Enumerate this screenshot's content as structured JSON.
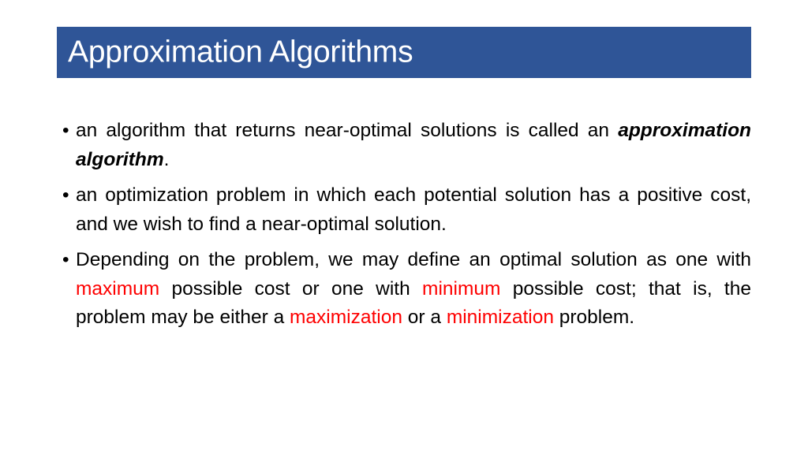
{
  "slide": {
    "title": "Approximation Algorithms",
    "banner_color": "#2f5597",
    "title_color": "#ffffff",
    "background_color": "#ffffff",
    "body_text_color": "#000000",
    "highlight_color": "#fe0000",
    "bullet_marker": "•"
  },
  "bullets": [
    {
      "id": "bullet-1",
      "segments": [
        {
          "text": "an algorithm that returns near-optimal solutions is called an ",
          "style": "normal"
        },
        {
          "text": "approximation algorithm",
          "style": "bold-italic"
        },
        {
          "text": ".",
          "style": "normal"
        }
      ],
      "plain": "an algorithm that returns near-optimal solutions is called an approximation algorithm."
    },
    {
      "id": "bullet-2",
      "segments": [
        {
          "text": "an optimization problem in which each potential solution has a positive cost, and we wish to find a near-optimal solution.",
          "style": "normal"
        }
      ],
      "plain": "an optimization problem in which each potential solution has a positive cost, and we wish to find a near-optimal solution."
    },
    {
      "id": "bullet-3",
      "segments": [
        {
          "text": "Depending on the problem, we may define an optimal solution as one with ",
          "style": "normal"
        },
        {
          "text": "maximum",
          "style": "red"
        },
        {
          "text": " possible cost or one with ",
          "style": "normal"
        },
        {
          "text": "minimum",
          "style": "red"
        },
        {
          "text": " possible cost; that is, the problem may be either a ",
          "style": "normal"
        },
        {
          "text": "maximization",
          "style": "red"
        },
        {
          "text": " or a ",
          "style": "normal"
        },
        {
          "text": "minimization",
          "style": "red"
        },
        {
          "text": " problem.",
          "style": "normal"
        }
      ],
      "plain": "Depending on the problem, we may define an optimal solution as one with maximum possible cost or one with minimum possible cost; that is, the problem may be either a maximization or a minimization problem."
    }
  ],
  "bullet_text": {
    "b1_s0": "an algorithm that returns near-optimal solutions is called an ",
    "b1_s1": "approximation algorithm",
    "b1_s2": ".",
    "b2_s0": "an optimization problem in which each potential solution has a positive cost, and we wish to find a near-optimal solution.",
    "b3_s0": "Depending on the problem, we may define an optimal solution as one with ",
    "b3_s1": "maximum",
    "b3_s2": " possible cost or one with ",
    "b3_s3": "minimum",
    "b3_s4": " possible cost; that is, the problem may be either a ",
    "b3_s5": "maximization",
    "b3_s6": " or a ",
    "b3_s7": "minimization",
    "b3_s8": " problem."
  }
}
